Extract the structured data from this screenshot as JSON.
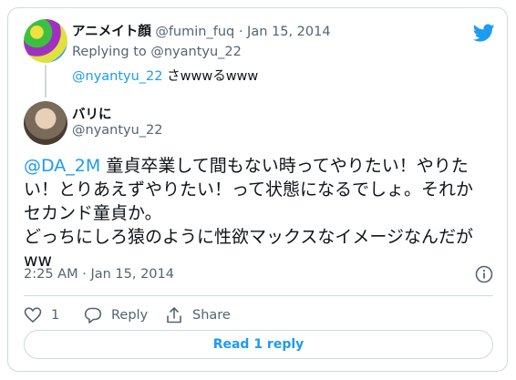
{
  "parent_tweet": {
    "display_name": "アニメイト顔",
    "handle": "@fumin_fuq",
    "separator": "·",
    "date": "Jan 15, 2014",
    "reply_label": "Replying to",
    "reply_handle": "@nyantyu_22",
    "text_mention": "@nyantyu_22",
    "text_body": " さwwwるwww"
  },
  "main_tweet": {
    "display_name": "バリに",
    "handle": "@nyantyu_22",
    "text_mention": "@DA_2M",
    "text_line1": " 童貞卒業して間もない時ってやりたい！やりたい！とりあえずやりたい！って状態になるでしょ。それかセカンド童貞か。",
    "text_line2": "どっちにしろ猿のように性欲マックスなイメージなんだがww",
    "time": "2:25 AM",
    "separator": "·",
    "date": "Jan 15, 2014"
  },
  "actions": {
    "like_count": "1",
    "reply_label": "Reply",
    "share_label": "Share"
  },
  "read_reply_label": "Read 1 reply",
  "colors": {
    "accent": "#1d9bf0",
    "muted": "#536471",
    "border": "#cfd9de"
  }
}
